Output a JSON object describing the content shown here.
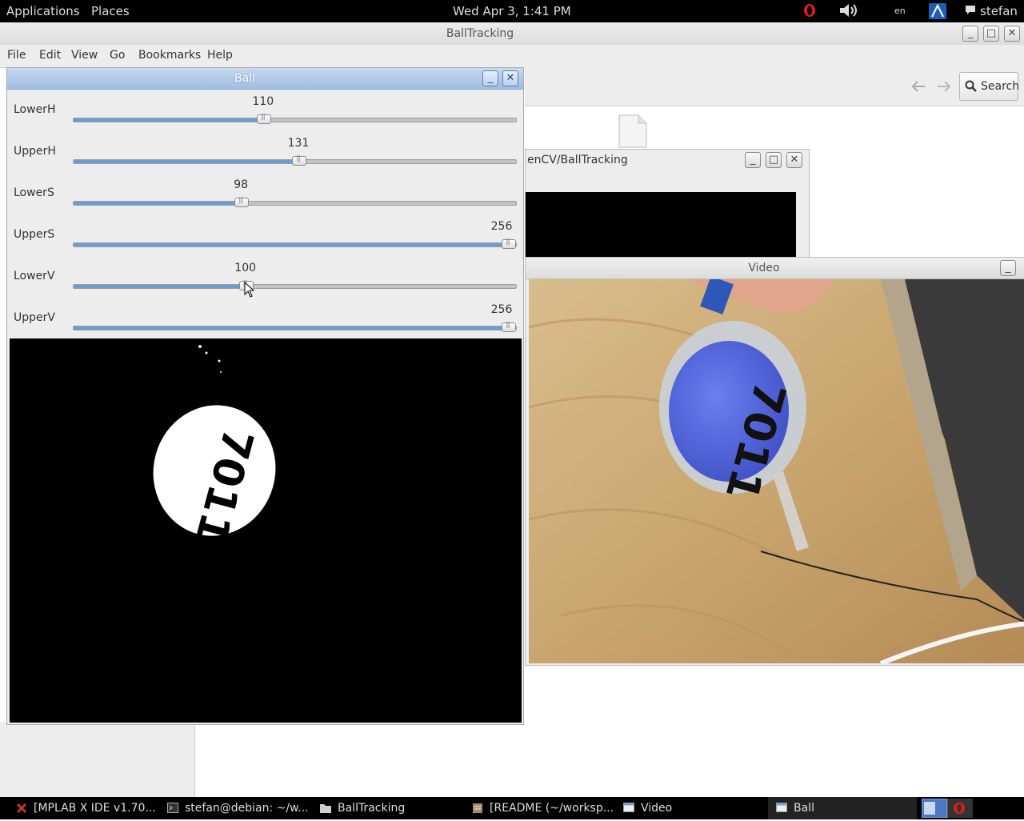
{
  "top_panel": {
    "menus": [
      "Applications",
      "Places"
    ],
    "clock": "Wed Apr  3,  1:41 PM",
    "language": "en",
    "user": "stefan"
  },
  "file_manager": {
    "title": "BallTracking",
    "menus": [
      "File",
      "Edit",
      "View",
      "Go",
      "Bookmarks",
      "Help"
    ],
    "search_label": "Search"
  },
  "terminal_window": {
    "title": "enCV/BallTracking"
  },
  "ball_window": {
    "title": "Ball",
    "sliders": [
      {
        "label": "LowerH",
        "value": "110",
        "fraction": 0.43
      },
      {
        "label": "UpperH",
        "value": "131",
        "fraction": 0.51
      },
      {
        "label": "LowerS",
        "value": "98",
        "fraction": 0.38
      },
      {
        "label": "UpperS",
        "value": "256",
        "fraction": 1.0
      },
      {
        "label": "LowerV",
        "value": "100",
        "fraction": 0.39
      },
      {
        "label": "UpperV",
        "value": "256",
        "fraction": 1.0
      }
    ],
    "mask_text": "7011"
  },
  "video_window": {
    "title": "Video",
    "ball_text": "7011"
  },
  "taskbar": {
    "tasks": [
      {
        "label": "[MPLAB X IDE v1.70...",
        "icon": "mplab-icon"
      },
      {
        "label": "stefan@debian: ~/w...",
        "icon": "terminal-icon"
      },
      {
        "label": "BallTracking",
        "icon": "folder-icon"
      },
      {
        "label": "[README (~/worksp...",
        "icon": "text-editor-icon"
      },
      {
        "label": "Video",
        "icon": "window-icon"
      },
      {
        "label": "Ball",
        "icon": "window-icon"
      }
    ]
  },
  "colors": {
    "slider_fill": "#6c9cd6",
    "ball_blue": "#5b6ee0",
    "wood": "#c9a66f"
  }
}
